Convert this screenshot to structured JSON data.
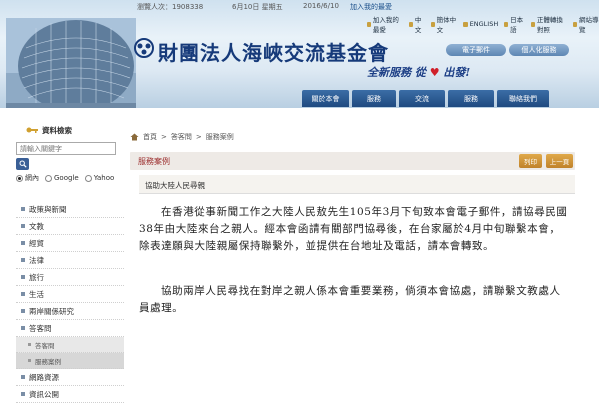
{
  "header": {
    "visitor_label": "瀏覽人次：1908338",
    "date_gregorian": "6月10日 星期五",
    "date_numeric": "2016/6/10",
    "favorite": "加入我的最愛",
    "top_links": [
      "加入我的最愛",
      "中文",
      "簡体中文",
      "ENGLISH",
      "日本語",
      "正體轉換對照",
      "網站導覽"
    ],
    "org_name": "財團法人海峽交流基金會",
    "slogan_part1": "全新服務 從",
    "slogan_part2": "出發!",
    "pill_buttons": [
      "電子郵件",
      "個人化服務"
    ],
    "nav": [
      "關於本會",
      "服務",
      "交流",
      "服務",
      "聯絡我們"
    ]
  },
  "sidebar": {
    "title": "資料檢索",
    "search_placeholder": "請輸入關鍵字",
    "radios": [
      {
        "label": "網內",
        "checked": true
      },
      {
        "label": "Google",
        "checked": false
      },
      {
        "label": "Yahoo",
        "checked": false
      }
    ],
    "menu": [
      {
        "label": "政策與新聞",
        "sub": false
      },
      {
        "label": "文教",
        "sub": false
      },
      {
        "label": "經貿",
        "sub": false
      },
      {
        "label": "法律",
        "sub": false
      },
      {
        "label": "旅行",
        "sub": false
      },
      {
        "label": "生活",
        "sub": false
      },
      {
        "label": "兩岸關係研究",
        "sub": false
      },
      {
        "label": "答客問",
        "sub": false
      },
      {
        "label": "答客問",
        "sub": true,
        "active": false
      },
      {
        "label": "服務案例",
        "sub": true,
        "active": true
      },
      {
        "label": "網路資源",
        "sub": false
      },
      {
        "label": "資訊公開",
        "sub": false
      }
    ]
  },
  "main": {
    "breadcrumb": [
      "首頁",
      "答客問",
      "服務案例"
    ],
    "section_title": "服務案例",
    "print_label": "列印",
    "prev_label": "上一頁",
    "article_title": "協助大陸人民尋親",
    "paragraphs": [
      "在香港從事新聞工作之大陸人民敖先生105年3月下旬致本會電子郵件，請協尋民國38年由大陸來台之親人。經本會函請有關部門協尋後，在台家屬於4月中旬聯繫本會，除表達願與大陸親屬保持聯繫外，並提供在台地址及電話，請本會轉致。",
      "協助兩岸人民尋找在對岸之親人係本會重要業務，倘須本會協處，請聯繫文教處人員處理。"
    ]
  },
  "colors": {
    "brand_blue": "#163a7a",
    "nav_blue": "#2a5a92",
    "section_red": "#9a2a2a",
    "button_gold": "#d0952f"
  }
}
